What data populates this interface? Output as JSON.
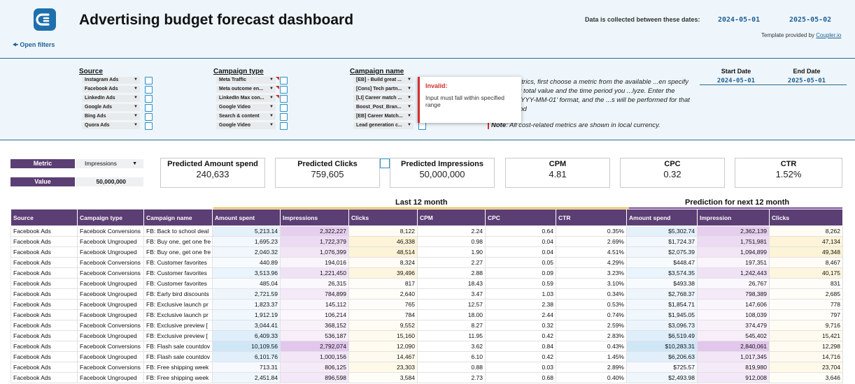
{
  "header": {
    "title": "Advertising budget forecast dashboard",
    "open_filters": "Open filters",
    "dates_label": "Data is collected between these dates:",
    "date_start": "2024-05-01",
    "date_end": "2025-05-02",
    "template_prefix": "Template provided by",
    "template_link": "Coupler.io",
    "logo_icon": "coupler-logo-icon"
  },
  "filters": {
    "source": {
      "heading": "Source",
      "items": [
        "Instagram Ads",
        "Facebook Ads",
        "LinkedIn Ads",
        "Google Ads",
        "Bing Ads",
        "Quora Ads"
      ]
    },
    "campaign_type": {
      "heading": "Campaign type",
      "items": [
        "Meta Traffic",
        "Meta outcome en...",
        "LinkedIn Max con...",
        "Google Video",
        "Search & content",
        "Google Video"
      ]
    },
    "campaign_name": {
      "heading": "Campaign name",
      "items": [
        "[EB] - Build great ...",
        "[Cons] Tech partn...",
        "[LI] Career match ...",
        "Boost_Post_Bran...",
        "[EB] Career Match...",
        "Lead generation c..."
      ]
    },
    "instructions": "...uture metrics, first choose a metric from the available ...en specify your target total value and the time period you ...lyze. Enter the dates in 'YYYY-MM-01' format, and the ...s will be performed for that entire period",
    "note_bold": "Note",
    "note_text": ": All cost-related metrics are shown in local currency.",
    "tooltip_title": "Invalid:",
    "tooltip_message": "Input must fall within specified range",
    "start_date_label": "Start Date",
    "end_date_label": "End Date",
    "start_date": "2024-05-01",
    "end_date": "2025-05-01"
  },
  "metric": {
    "metric_label": "Metric",
    "metric_value": "Impressions",
    "value_label": "Value",
    "value_value": "50,000,000"
  },
  "kpis": [
    {
      "title": "Predicted Amount spend",
      "value": "240,633"
    },
    {
      "title": "Predicted Clicks",
      "value": "759,605"
    },
    {
      "title": "Predicted Impressions",
      "value": "50,000,000"
    },
    {
      "title": "CPM",
      "value": "4.81"
    },
    {
      "title": "CPC",
      "value": "0.32"
    },
    {
      "title": "CTR",
      "value": "1.52%"
    }
  ],
  "sections": {
    "last12": "Last 12 month",
    "prediction": "Prediction for next 12 month"
  },
  "colors": {
    "header_purple": "#5b3e74",
    "accent_blue": "#1f5f96",
    "invalid_red": "#d32f2f",
    "spend_highlight": "#cfe6f7",
    "impressions_highlight": "#e2c6ec",
    "clicks_highlight": "#fdf3d6"
  },
  "table": {
    "columns": [
      "Source",
      "Campaign type",
      "Campaign name",
      "Amount spent",
      "Impressions",
      "Clicks",
      "CPM",
      "CPC",
      "CTR",
      "Amount spend",
      "Impression",
      "Clicks"
    ],
    "rows": [
      [
        "Facebook Ads",
        "Facebook Conversions",
        "FB: Back to school deal",
        "5,213.14",
        "2,322,227",
        "8,122",
        "2.24",
        "0.64",
        "0.35%",
        "$5,302.74",
        "2,362,139",
        "8,262"
      ],
      [
        "Facebook Ads",
        "Facebook Ungrouped",
        "FB: Buy one, get one fre",
        "1,695.23",
        "1,722,379",
        "46,338",
        "0.98",
        "0.04",
        "2.69%",
        "$1,724.37",
        "1,751,981",
        "47,134"
      ],
      [
        "Facebook Ads",
        "Facebook Ungrouped",
        "FB: Buy one, get one fre",
        "2,040.32",
        "1,076,399",
        "48,514",
        "1.90",
        "0.04",
        "4.51%",
        "$2,075.39",
        "1,094,899",
        "49,348"
      ],
      [
        "Facebook Ads",
        "Facebook Conversions",
        "FB: Customer favorites",
        "440.89",
        "194,016",
        "8,324",
        "2.27",
        "0.05",
        "4.29%",
        "$448.47",
        "197,351",
        "8,467"
      ],
      [
        "Facebook Ads",
        "Facebook Conversions",
        "FB: Customer favorites",
        "3,513.96",
        "1,221,450",
        "39,496",
        "2.88",
        "0.09",
        "3.23%",
        "$3,574.35",
        "1,242,443",
        "40,175"
      ],
      [
        "Facebook Ads",
        "Facebook Ungrouped",
        "FB: Customer favorites",
        "485.04",
        "26,315",
        "817",
        "18.43",
        "0.59",
        "3.10%",
        "$493.38",
        "26,767",
        "831"
      ],
      [
        "Facebook Ads",
        "Facebook Ungrouped",
        "FB: Early bird discounts",
        "2,721.59",
        "784,899",
        "2,640",
        "3.47",
        "1.03",
        "0.34%",
        "$2,768.37",
        "798,389",
        "2,685"
      ],
      [
        "Facebook Ads",
        "Facebook Ungrouped",
        "FB: Exclusive launch pr",
        "1,823.37",
        "145,112",
        "765",
        "12.57",
        "2.38",
        "0.53%",
        "$1,854.71",
        "147,606",
        "778"
      ],
      [
        "Facebook Ads",
        "Facebook Ungrouped",
        "FB: Exclusive launch pr",
        "1,912.19",
        "106,214",
        "784",
        "18.00",
        "2.44",
        "0.74%",
        "$1,945.05",
        "108,039",
        "797"
      ],
      [
        "Facebook Ads",
        "Facebook Conversions",
        "FB: Exclusive preview [",
        "3,044.41",
        "368,152",
        "9,552",
        "8.27",
        "0.32",
        "2.59%",
        "$3,096.73",
        "374,479",
        "9,716"
      ],
      [
        "Facebook Ads",
        "Facebook Ungrouped",
        "FB: Exclusive preview [",
        "6,409.33",
        "536,187",
        "15,160",
        "11.95",
        "0.42",
        "2.83%",
        "$6,519.49",
        "545,402",
        "15,421"
      ],
      [
        "Facebook Ads",
        "Facebook Conversions",
        "FB: Flash sale countdov",
        "10,109.56",
        "2,792,074",
        "12,090",
        "3.62",
        "0.84",
        "0.43%",
        "$10,283.31",
        "2,840,061",
        "12,298"
      ],
      [
        "Facebook Ads",
        "Facebook Ungrouped",
        "FB: Flash sale countdov",
        "6,101.76",
        "1,000,156",
        "14,467",
        "6.10",
        "0.42",
        "1.45%",
        "$6,206.63",
        "1,017,345",
        "14,716"
      ],
      [
        "Facebook Ads",
        "Facebook Conversions",
        "FB: Free shipping week",
        "713.31",
        "806,125",
        "23,303",
        "0.88",
        "0.03",
        "2.89%",
        "$725.57",
        "819,980",
        "23,704"
      ],
      [
        "Facebook Ads",
        "Facebook Ungrouped",
        "FB: Free shipping week",
        "2,451.84",
        "896,598",
        "3,584",
        "2.73",
        "0.68",
        "0.40%",
        "$2,493.98",
        "912,008",
        "3,646"
      ]
    ]
  }
}
